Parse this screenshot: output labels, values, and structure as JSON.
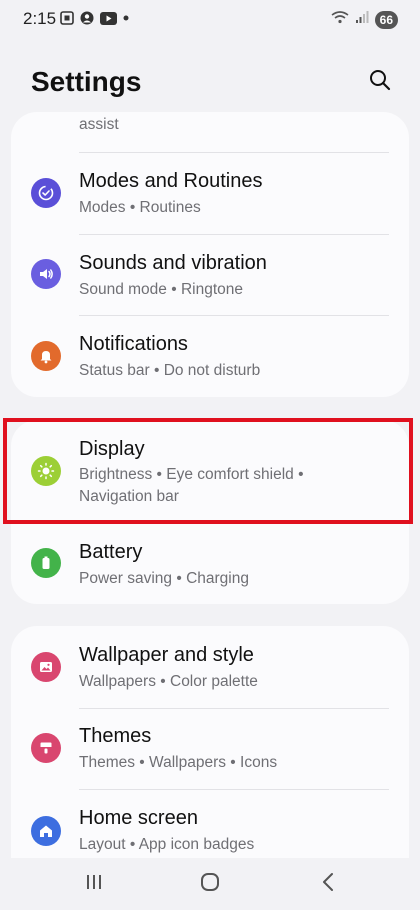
{
  "status_bar": {
    "time": "2:15",
    "battery": "66"
  },
  "header": {
    "title": "Settings"
  },
  "card1": {
    "partial_text": "assist",
    "items": [
      {
        "title": "Modes and Routines",
        "subtitle": "Modes  •  Routines",
        "icon": "modes-icon",
        "color": "#5a4fd8"
      },
      {
        "title": "Sounds and vibration",
        "subtitle": "Sound mode  •  Ringtone",
        "icon": "sound-icon",
        "color": "#6a5ee0"
      },
      {
        "title": "Notifications",
        "subtitle": "Status bar  •  Do not disturb",
        "icon": "bell-icon",
        "color": "#e26a2c"
      }
    ]
  },
  "card2": {
    "items": [
      {
        "title": "Display",
        "subtitle": "Brightness  •  Eye comfort shield  •",
        "subtitle2": "Navigation bar",
        "icon": "brightness-icon",
        "color": "#9ccf36"
      },
      {
        "title": "Battery",
        "subtitle": "Power saving  •  Charging",
        "icon": "battery-icon",
        "color": "#43b34a"
      }
    ]
  },
  "card3": {
    "items": [
      {
        "title": "Wallpaper and style",
        "subtitle": "Wallpapers  •  Color palette",
        "icon": "wallpaper-icon",
        "color": "#d9466f"
      },
      {
        "title": "Themes",
        "subtitle": "Themes  •  Wallpapers  •  Icons",
        "icon": "themes-icon",
        "color": "#d9466f"
      },
      {
        "title": "Home screen",
        "subtitle": "Layout  •  App icon badges",
        "icon": "home-icon",
        "color": "#3d6ee0"
      }
    ]
  },
  "highlight_color": "#e0101e"
}
